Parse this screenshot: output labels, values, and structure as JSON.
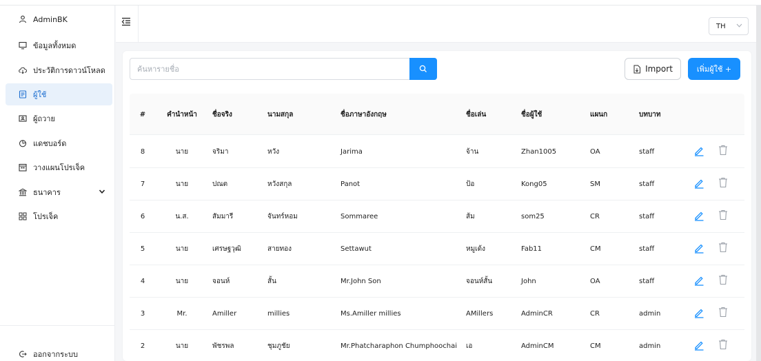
{
  "sidebar": {
    "items": [
      {
        "label": "AdminBK",
        "icon": "user-icon"
      },
      {
        "label": "ข้อมูลทั้งหมด",
        "icon": "monitor-icon"
      },
      {
        "label": "ประวัติการดาวน์โหลด",
        "icon": "cloud-download-icon"
      },
      {
        "label": "ผู้ใช้",
        "icon": "user-list-icon"
      },
      {
        "label": "ผู้ถวาย",
        "icon": "id-card-icon"
      },
      {
        "label": "แดชบอร์ด",
        "icon": "pie-chart-icon"
      },
      {
        "label": "วางแผนโปรเจ็ค",
        "icon": "calendar-icon"
      },
      {
        "label": "ธนาคาร",
        "icon": "bank-icon"
      },
      {
        "label": "โปรเจ็ค",
        "icon": "project-icon"
      }
    ],
    "active_index": 3,
    "logout_label": "ออกจากระบบ"
  },
  "header": {
    "language": "TH"
  },
  "toolbar": {
    "search_placeholder": "ค้นหารายชื่อ",
    "import_label": "Import",
    "add_user_label": "เพิ่มผู้ใช้ +"
  },
  "table": {
    "columns": [
      "#",
      "คำนำหน้า",
      "ชื่อจริง",
      "นามสกุล",
      "ชื่อภาษาอังกฤษ",
      "ชื่อเล่น",
      "ชื่อผู้ใช้",
      "แผนก",
      "บทบาท"
    ],
    "rows": [
      {
        "no": "8",
        "prefix": "นาย",
        "first_name": "จริมา",
        "last_name": "หวัง",
        "english_name": "Jarima",
        "nickname": "จ้าน",
        "username": "Zhan1005",
        "department": "OA",
        "role": "staff"
      },
      {
        "no": "7",
        "prefix": "นาย",
        "first_name": "ปณต",
        "last_name": "หวังสกุล",
        "english_name": "Panot",
        "nickname": "ป้อ",
        "username": "Kong05",
        "department": "SM",
        "role": "staff"
      },
      {
        "no": "6",
        "prefix": "น.ส.",
        "first_name": "สัมมารี",
        "last_name": "จันทร์หอม",
        "english_name": "Sommaree",
        "nickname": "ส้ม",
        "username": "som25",
        "department": "CR",
        "role": "staff"
      },
      {
        "no": "5",
        "prefix": "นาย",
        "first_name": "เศรษฐวุฒิ",
        "last_name": "สายทอง",
        "english_name": "Settawut",
        "nickname": "หมูเด้ง",
        "username": "Fab11",
        "department": "CM",
        "role": "staff"
      },
      {
        "no": "4",
        "prefix": "นาย",
        "first_name": "จอนห์",
        "last_name": "สั้น",
        "english_name": "Mr.John Son",
        "nickname": "จอนห์สั้น",
        "username": "John",
        "department": "OA",
        "role": "staff"
      },
      {
        "no": "3",
        "prefix": "Mr.",
        "first_name": "Amiller",
        "last_name": "millies",
        "english_name": "Ms.Amiller millies",
        "nickname": "AMillers",
        "username": "AdminCR",
        "department": "CR",
        "role": "admin"
      },
      {
        "no": "2",
        "prefix": "นาย",
        "first_name": "พัชรพล",
        "last_name": "ชุมภูชัย",
        "english_name": "Mr.Phatcharaphon Chumphoochai",
        "nickname": "เอ",
        "username": "AdminCM",
        "department": "CM",
        "role": "admin"
      }
    ]
  },
  "colors": {
    "primary": "#1890ff",
    "active_bg": "#e8f1fb",
    "active_text": "#1e6fd0",
    "page_bg": "#f5f6f8",
    "delete_icon": "#9aa0a8"
  }
}
